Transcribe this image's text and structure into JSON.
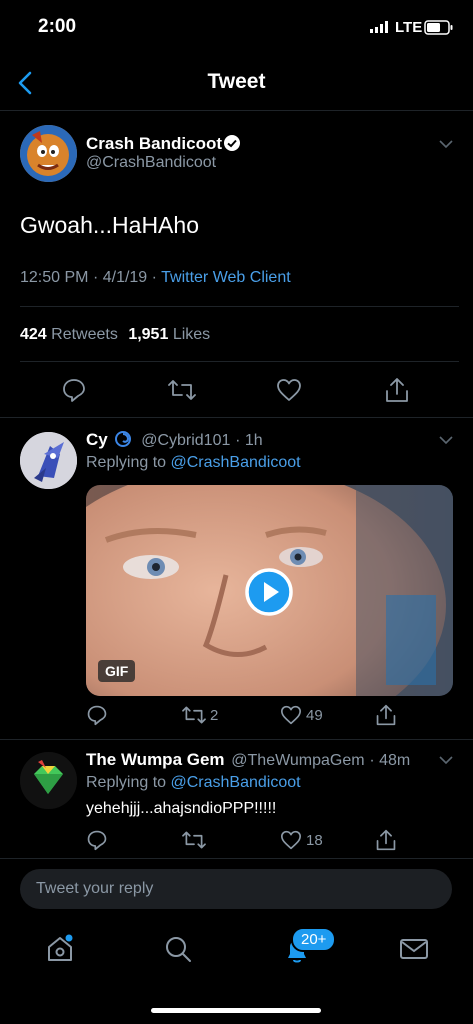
{
  "status": {
    "time": "2:00",
    "network": "LTE"
  },
  "header": {
    "title": "Tweet"
  },
  "tweet": {
    "author_name": "Crash Bandicoot",
    "handle": "@CrashBandicoot",
    "text": "Gwoah...HaHAho",
    "time": "12:50 PM",
    "date": "4/1/19",
    "source": "Twitter Web Client",
    "sep": "·",
    "retweets_count": "424",
    "retweets_label": "Retweets",
    "likes_count": "1,951",
    "likes_label": "Likes"
  },
  "replies": [
    {
      "name": "Cy",
      "handle": "@Cybrid101",
      "time": "· 1h",
      "replying_label": "Replying to",
      "replying_to": "@CrashBandicoot",
      "media_badge": "GIF",
      "retweets": "2",
      "likes": "49"
    },
    {
      "name": "The Wumpa Gem",
      "handle": "@TheWumpaGem",
      "time": "· 48m",
      "replying_label": "Replying to",
      "replying_to": "@CrashBandicoot",
      "text": "yehehjjj...ahajsndioPPP!!!!!",
      "likes": "18"
    }
  ],
  "composer": {
    "placeholder": "Tweet your reply"
  },
  "tabbar": {
    "notifications_badge": "20+"
  },
  "colors": {
    "accent": "#1d9bf0",
    "muted": "#8b98a5",
    "background": "#000000"
  }
}
